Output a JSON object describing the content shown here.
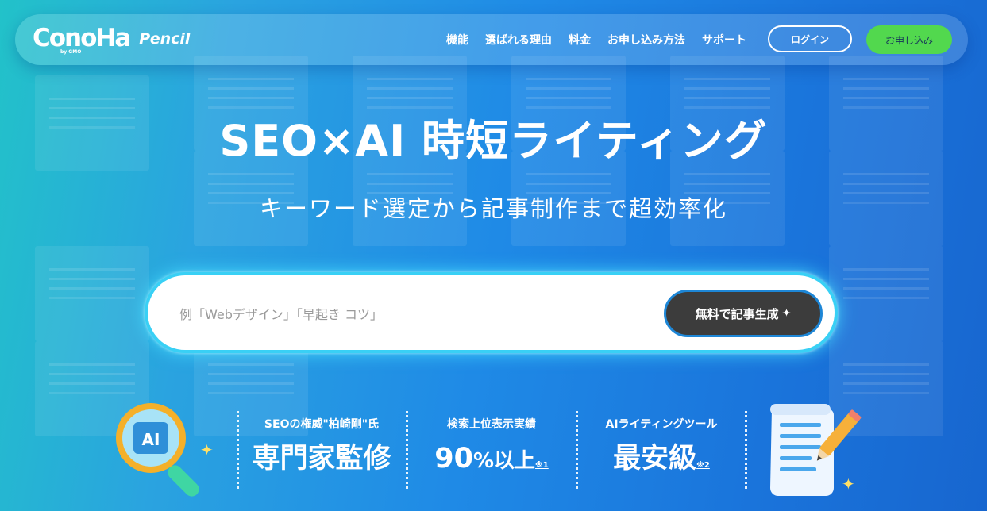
{
  "header": {
    "logo_main": "ConoHa",
    "logo_by": "by GMO",
    "logo_sub": "Pencil",
    "nav": [
      "機能",
      "選ばれる理由",
      "料金",
      "お申し込み方法",
      "サポート"
    ],
    "login_label": "ログイン",
    "signup_label": "お申し込み"
  },
  "hero": {
    "title": "SEO×AI 時短ライティング",
    "subtitle": "キーワード選定から記事制作まで超効率化"
  },
  "search": {
    "placeholder": "例「Webデザイン」「早起き コツ」",
    "button_label": "無料で記事生成"
  },
  "features": [
    {
      "caption": "SEOの権威\"柏崎剛\"氏",
      "main": "専門家監修",
      "unit": "",
      "note": ""
    },
    {
      "caption": "検索上位表示実績",
      "main": "90",
      "unit": "%以上",
      "note": "※1"
    },
    {
      "caption": "AIライティングツール",
      "main": "最安級",
      "unit": "",
      "note": "※2"
    }
  ],
  "illustrations": {
    "badge_text": "AI"
  },
  "colors": {
    "accent_green": "#52d84e",
    "button_dark": "#3c3c3c",
    "glow": "#39d0f5"
  }
}
